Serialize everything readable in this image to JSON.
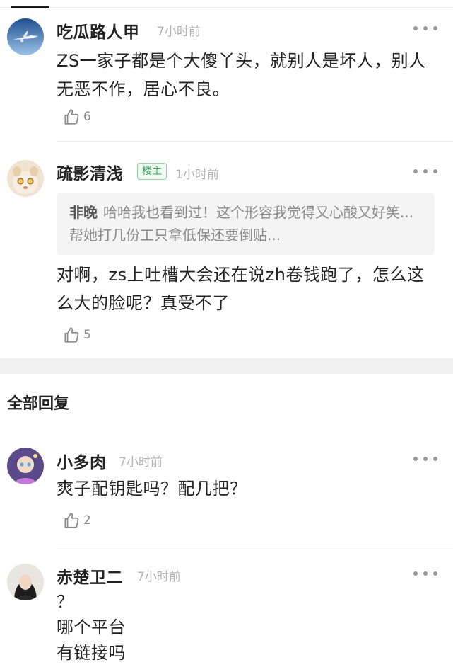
{
  "comments_top": [
    {
      "name": "吃瓜路人甲",
      "time": "7小时前",
      "text": "ZS一家子都是个大傻丫头，就别人是坏人，别人无恶不作，居心不良。",
      "likes": "6"
    },
    {
      "name": "疏影清浅",
      "badge": "楼主",
      "time": "1小时前",
      "quote_name": "非晚",
      "quote_text": "哈哈我也看到过！这个形容我觉得又心酸又好笑...帮她打几份工只拿低保还要倒贴...",
      "text": "对啊，zs上吐槽大会还在说zh卷钱跑了，怎么这么大的脸呢？真受不了",
      "likes": "5"
    }
  ],
  "section": {
    "title": "全部回复"
  },
  "replies": [
    {
      "name": "小多肉",
      "time": "7小时前",
      "text": "爽子配钥匙吗？配几把？",
      "likes": "2"
    },
    {
      "name": "赤楚卫二",
      "time": "7小时前",
      "lines": [
        "？",
        "哪个平台",
        "有链接吗"
      ]
    }
  ],
  "icons": {
    "like": "thumbs-up-icon",
    "more": "more-dots-icon"
  },
  "colors": {
    "badge_green": "#3aa55b",
    "meta_gray": "#b2b2b2",
    "separator_band": "#f0f0f0"
  }
}
